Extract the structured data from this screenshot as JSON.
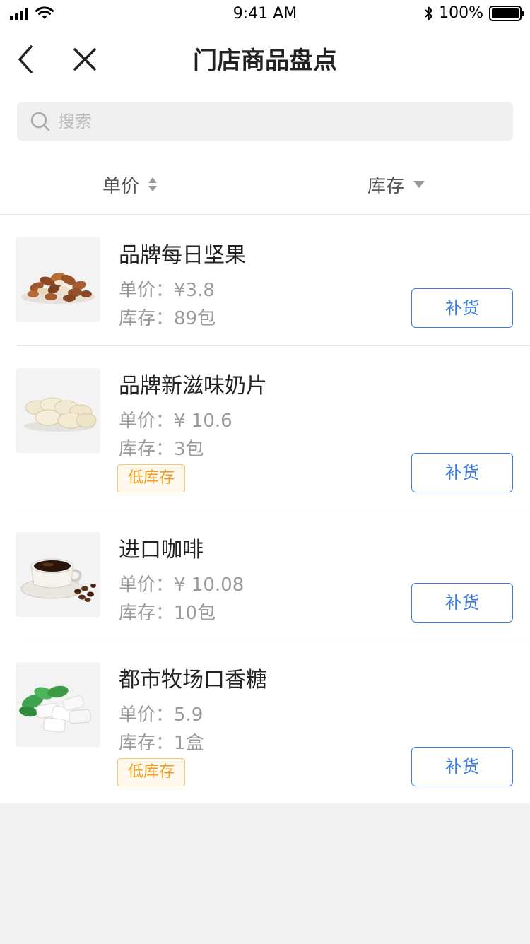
{
  "status_bar": {
    "time": "9:41 AM",
    "battery": "100%"
  },
  "nav": {
    "title": "门店商品盘点"
  },
  "search": {
    "placeholder": "搜索"
  },
  "sort": {
    "price_label": "单价",
    "stock_label": "库存"
  },
  "products": [
    {
      "name": "品牌每日坚果",
      "price": "单价：¥3.8",
      "stock": "库存：89包",
      "badge": "",
      "button": "补货",
      "image": "mixed-nuts-image"
    },
    {
      "name": "品牌新滋味奶片",
      "price": "单价：¥ 10.6",
      "stock": "库存：3包",
      "badge": "低库存",
      "button": "补货",
      "image": "milk-tablets-image"
    },
    {
      "name": "进口咖啡",
      "price": "单价：¥ 10.08",
      "stock": "库存：10包",
      "badge": "",
      "button": "补货",
      "image": "coffee-cup-image"
    },
    {
      "name": "都市牧场口香糖",
      "price": "单价：5.9",
      "stock": "库存：1盒",
      "badge": "低库存",
      "button": "补货",
      "image": "chewing-gum-image"
    }
  ],
  "colors": {
    "accent": "#3a7de8",
    "badge_text": "#f0a020",
    "badge_bg": "#fff8ec",
    "muted_text": "#9a9a9a",
    "background": "#f2f2f2"
  }
}
